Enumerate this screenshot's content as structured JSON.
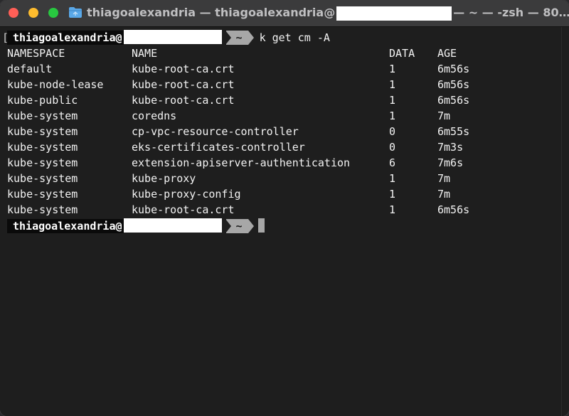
{
  "window": {
    "title_prefix": "thiagoalexandria — thiagoalexandria@",
    "title_suffix": "— ~ — -zsh — 80…"
  },
  "prompt": {
    "user": "thiagoalexandria@",
    "dir": "~",
    "command": "k get cm -A"
  },
  "table": {
    "headers": [
      "NAMESPACE",
      "NAME",
      "DATA",
      "AGE"
    ],
    "rows": [
      [
        "default",
        "kube-root-ca.crt",
        "1",
        "6m56s"
      ],
      [
        "kube-node-lease",
        "kube-root-ca.crt",
        "1",
        "6m56s"
      ],
      [
        "kube-public",
        "kube-root-ca.crt",
        "1",
        "6m56s"
      ],
      [
        "kube-system",
        "coredns",
        "1",
        "7m"
      ],
      [
        "kube-system",
        "cp-vpc-resource-controller",
        "0",
        "6m55s"
      ],
      [
        "kube-system",
        "eks-certificates-controller",
        "0",
        "7m3s"
      ],
      [
        "kube-system",
        "extension-apiserver-authentication",
        "6",
        "7m6s"
      ],
      [
        "kube-system",
        "kube-proxy",
        "1",
        "7m"
      ],
      [
        "kube-system",
        "kube-proxy-config",
        "1",
        "7m"
      ],
      [
        "kube-system",
        "kube-root-ca.crt",
        "1",
        "6m56s"
      ]
    ]
  },
  "colors": {
    "close": "#ff5f57",
    "minimize": "#febc2e",
    "maximize": "#28c840",
    "terminal_bg": "#1e1e1e",
    "folder_icon": "#5aa8e8"
  }
}
